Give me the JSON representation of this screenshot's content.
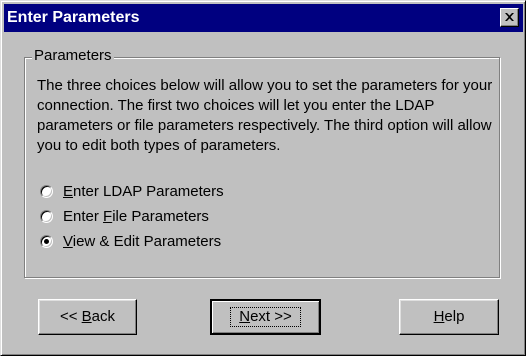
{
  "window": {
    "title": "Enter Parameters",
    "close_icon": "close-x-icon"
  },
  "group": {
    "label": "Parameters",
    "description": "The three choices below will allow you to set the parameters for your connection.  The first two choices will let you enter the LDAP parameters or file parameters respectively.  The third option will allow you to edit both types of parameters."
  },
  "options": [
    {
      "pre": "",
      "mnemonic": "E",
      "post": "nter LDAP Parameters",
      "selected": false
    },
    {
      "pre": "Enter ",
      "mnemonic": "F",
      "post": "ile Parameters",
      "selected": false
    },
    {
      "pre": "",
      "mnemonic": "V",
      "post": "iew & Edit Parameters",
      "selected": true
    }
  ],
  "buttons": {
    "back": {
      "pre": "<< ",
      "mnemonic": "B",
      "post": "ack"
    },
    "next": {
      "pre": "",
      "mnemonic": "N",
      "post": "ext >>"
    },
    "help": {
      "pre": "",
      "mnemonic": "H",
      "post": "elp"
    }
  }
}
